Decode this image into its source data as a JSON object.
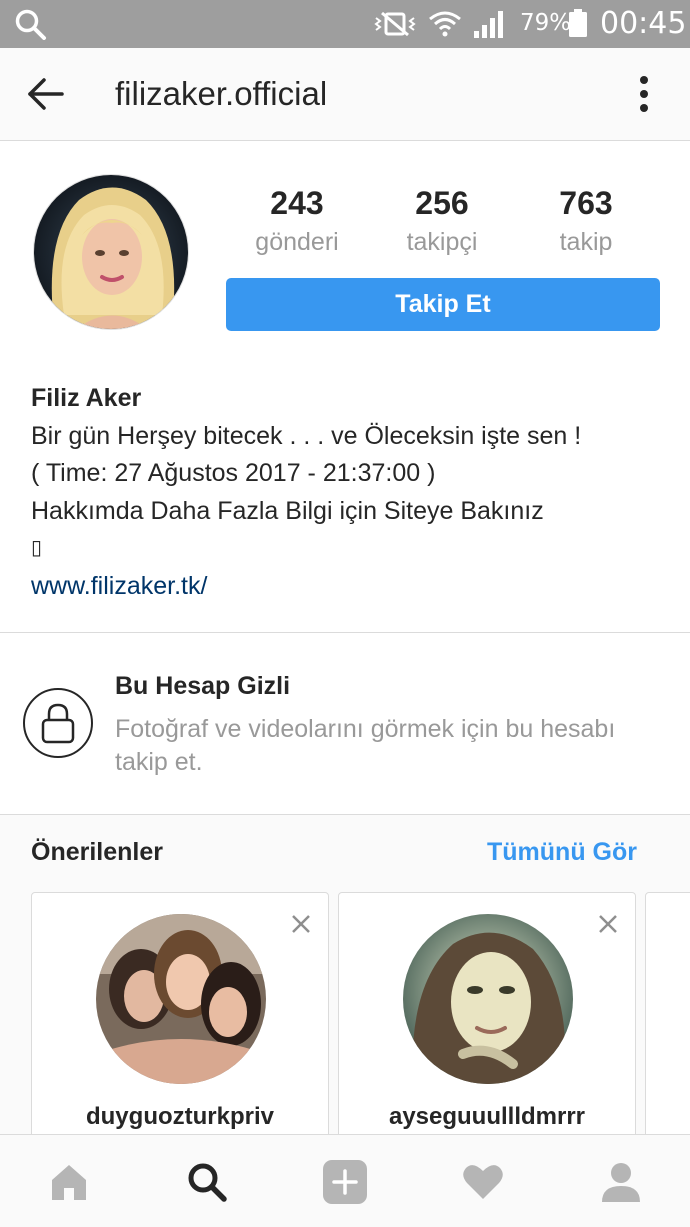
{
  "status_bar": {
    "battery_percent": "79%",
    "time": "00:45"
  },
  "header": {
    "username": "filizaker.official"
  },
  "profile": {
    "stats": [
      {
        "value": "243",
        "label": "gönderi"
      },
      {
        "value": "256",
        "label": "takipçi"
      },
      {
        "value": "763",
        "label": "takip"
      }
    ],
    "follow_label": "Takip Et",
    "full_name": "Filiz Aker",
    "bio_lines": [
      "Bir gün Herşey bitecek . . . ve Öleceksin işte sen !",
      "( Time: 27 Ağustos 2017 - 21:37:00 )",
      "Hakkımda Daha Fazla Bilgi için Siteye Bakınız",
      "▯"
    ],
    "website": "www.filizaker.tk/"
  },
  "private_notice": {
    "title": "Bu Hesap Gizli",
    "description": "Fotoğraf ve videolarını görmek için bu hesabı takip et."
  },
  "suggestions": {
    "title": "Önerilenler",
    "see_all": "Tümünü Gör",
    "cards": [
      {
        "username": "duyguozturkpriv"
      },
      {
        "username": "ayseguuullldmrrr"
      }
    ]
  },
  "colors": {
    "accent": "#3897f0",
    "link": "#003569",
    "status_bar": "#9e9e9e",
    "muted_text": "#999999"
  },
  "icons": {
    "status_bar": [
      "search-icon",
      "vibrate-icon",
      "wifi-icon",
      "signal-icon",
      "battery-icon"
    ],
    "header": [
      "back-arrow-icon",
      "more-vertical-icon"
    ],
    "bottom_nav": [
      "home-icon",
      "search-icon",
      "add-post-icon",
      "heart-icon",
      "profile-icon"
    ]
  }
}
